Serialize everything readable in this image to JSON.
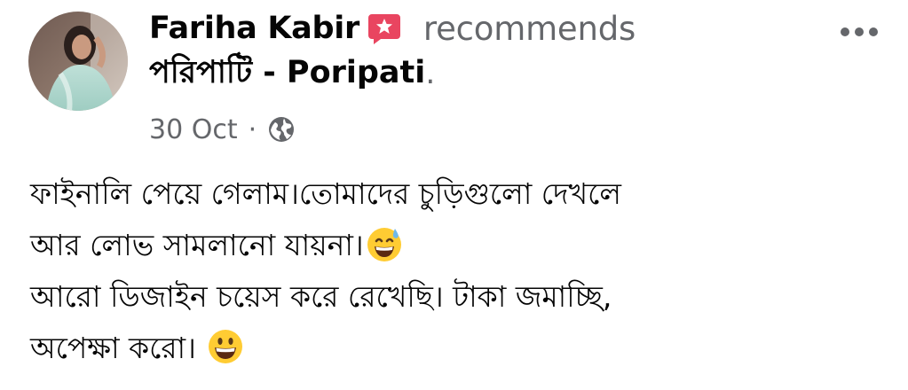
{
  "post": {
    "author": "Fariha Kabir",
    "action": "recommends",
    "page_name": "পরিপাটি - Poripati",
    "page_suffix": ".",
    "date": "30 Oct",
    "separator": "·",
    "privacy_icon": "globe-icon",
    "recommend_icon": "recommend-star-icon",
    "more_icon": "more-options-icon",
    "body_lines": [
      "ফাইনালি পেয়ে গেলাম।তোমাদের চুড়িগুলো দেখলে",
      "আর লোভ সামলানো যায়না।",
      "আরো ডিজাইন চয়েস করে রেখেছি। টাকা জমাচ্ছি,",
      "অপেক্ষা করো। "
    ],
    "emojis": [
      "grinning-sweat-emoji",
      "grinning-face-emoji"
    ]
  },
  "colors": {
    "text_primary": "#050505",
    "text_secondary": "#65676b",
    "recommend_badge": "#e94560",
    "emoji_yellow": "#ffcc33"
  }
}
